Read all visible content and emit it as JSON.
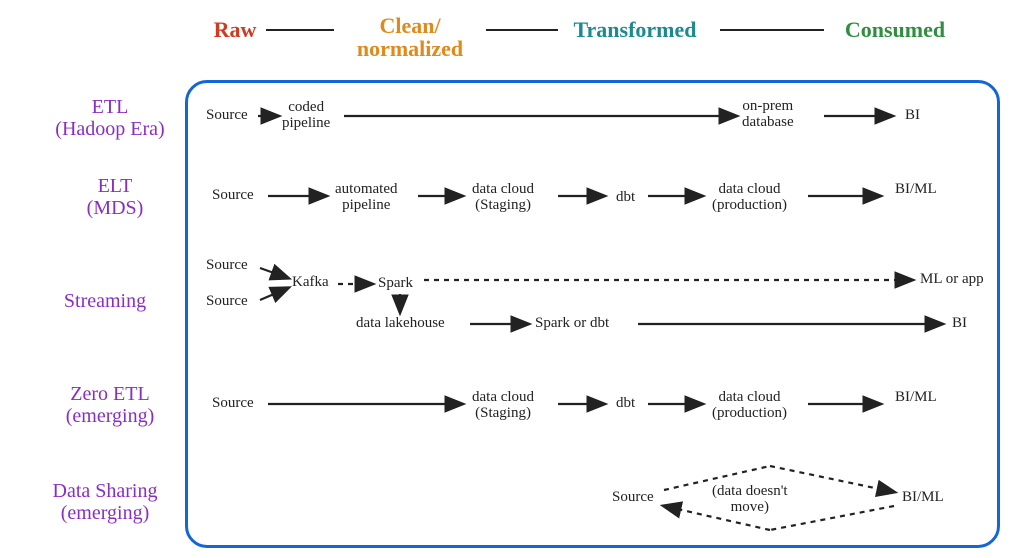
{
  "stages": {
    "raw": {
      "label": "Raw",
      "color": "#d13b1f"
    },
    "clean": {
      "label": "Clean/\nnormalized",
      "color": "#e08a1c"
    },
    "trans": {
      "label": "Transformed",
      "color": "#1c8a8f"
    },
    "cons": {
      "label": "Consumed",
      "color": "#2f8f3f"
    }
  },
  "rows": {
    "etl": "ETL\n(Hadoop Era)",
    "elt": "ELT\n(MDS)",
    "stream": "Streaming",
    "zero": "Zero ETL\n(emerging)",
    "share": "Data Sharing\n(emerging)"
  },
  "nodes": {
    "etl_source": "Source",
    "etl_coded": "coded\npipeline",
    "etl_db": "on-prem\ndatabase",
    "etl_bi": "BI",
    "elt_source": "Source",
    "elt_auto": "automated\npipeline",
    "elt_staging": "data cloud\n(Staging)",
    "elt_dbt": "dbt",
    "elt_prod": "data cloud\n(production)",
    "elt_biml": "BI/ML",
    "str_src1": "Source",
    "str_src2": "Source",
    "str_kafka": "Kafka",
    "str_spark": "Spark",
    "str_lake": "data lakehouse",
    "str_sparkdbt": "Spark or dbt",
    "str_mlapp": "ML or app",
    "str_bi": "BI",
    "zero_source": "Source",
    "zero_staging": "data cloud\n(Staging)",
    "zero_dbt": "dbt",
    "zero_prod": "data cloud\n(production)",
    "zero_biml": "BI/ML",
    "share_source": "Source",
    "share_note": "(data doesn't\nmove)",
    "share_biml": "BI/ML"
  }
}
